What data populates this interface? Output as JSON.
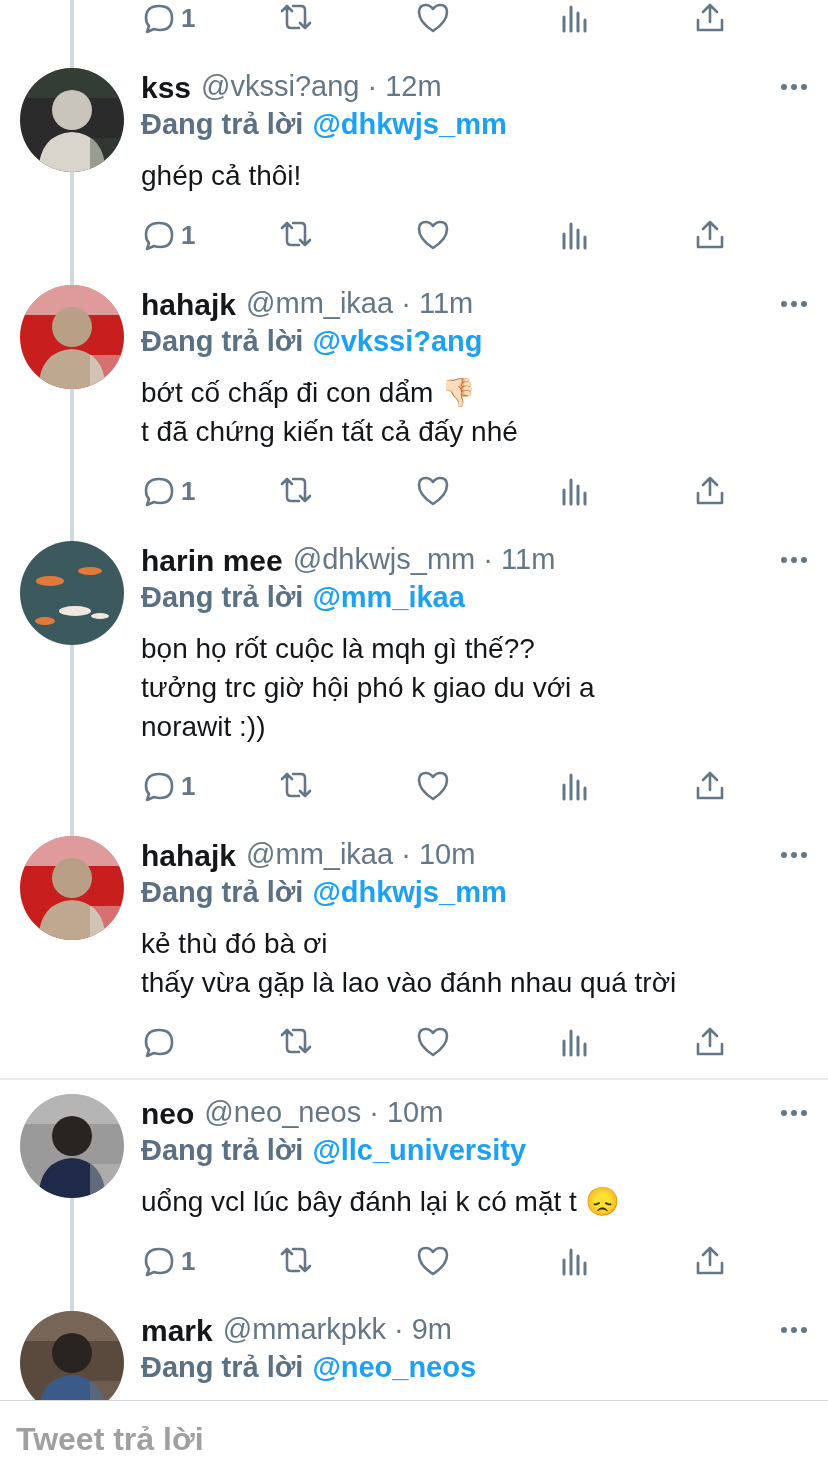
{
  "top_actions": {
    "reply_count": "1",
    "thread_line": true
  },
  "tweets": [
    {
      "name": "kss",
      "meta": "@vkssi?ang · 12m",
      "reply_label": "Đang trả lời",
      "reply_to": "@dhkwjs_mm",
      "lines": [
        "ghép cả thôi!"
      ],
      "reply_count": "1",
      "thread_line": true,
      "divider_after": false
    },
    {
      "name": "hahajk",
      "meta": "@mm_ikaa · 11m",
      "reply_label": "Đang trả lời",
      "reply_to": "@vkssi?ang",
      "lines": [
        "bớt cố chấp đi con dẩm 👎🏻",
        "t đã chứng kiến tất cả đấy nhé"
      ],
      "reply_count": "1",
      "thread_line": true,
      "divider_after": false
    },
    {
      "name": "harin mee",
      "meta": "@dhkwjs_mm · 11m",
      "reply_label": "Đang trả lời",
      "reply_to": "@mm_ikaa",
      "lines": [
        "bọn họ rốt cuộc là mqh gì thế??",
        "tưởng trc giờ hội phó k giao du với a",
        "norawit :))"
      ],
      "reply_count": "1",
      "thread_line": true,
      "divider_after": false
    },
    {
      "name": "hahajk",
      "meta": "@mm_ikaa · 10m",
      "reply_label": "Đang trả lời",
      "reply_to": "@dhkwjs_mm",
      "lines": [
        "kẻ thù đó bà ơi",
        "thấy vừa gặp là lao vào đánh nhau quá trời"
      ],
      "thread_line": false,
      "divider_after": true
    },
    {
      "name": "neo",
      "meta": "@neo_neos · 10m",
      "reply_label": "Đang trả lời",
      "reply_to": "@llc_university",
      "lines": [
        "uổng vcl lúc bây đánh lại k có mặt t 😞"
      ],
      "reply_count": "1",
      "thread_line": true,
      "divider_after": false
    },
    {
      "name": "mark",
      "meta": "@mmarkpkk · 9m",
      "reply_label": "Đang trả lời",
      "reply_to": "@neo_neos",
      "thread_line": false,
      "divider_after": false
    }
  ],
  "reply_box": {
    "placeholder": "Tweet trả lời"
  }
}
